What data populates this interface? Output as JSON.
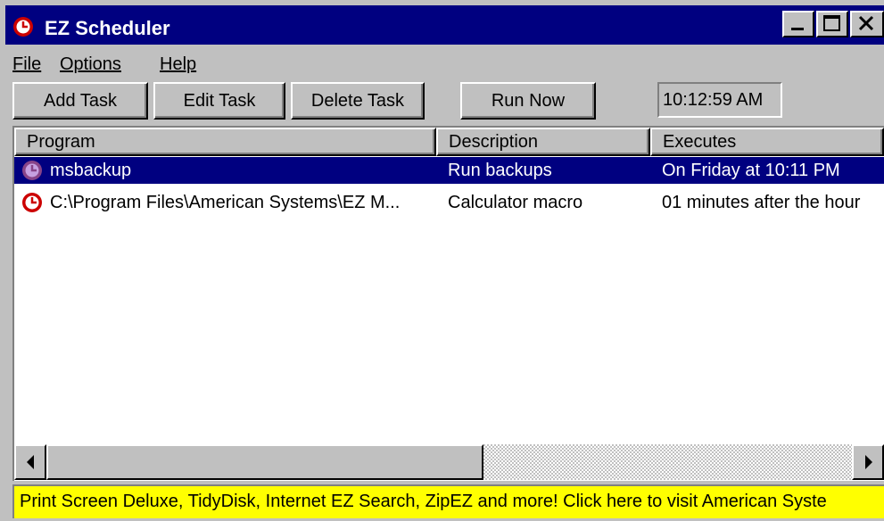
{
  "window": {
    "title": "EZ Scheduler",
    "icon": "clock-icon",
    "controls": [
      "minimize",
      "maximize",
      "close"
    ]
  },
  "menu": {
    "file": "File",
    "options": "Options",
    "help": "Help"
  },
  "toolbar": {
    "add_task": "Add Task",
    "edit_task": "Edit Task",
    "delete_task": "Delete Task",
    "run_now": "Run Now",
    "clock": "10:12:59 AM"
  },
  "table": {
    "columns": [
      "Program",
      "Description",
      "Executes"
    ],
    "rows": [
      {
        "program": "msbackup",
        "description": "Run backups",
        "executes": "On Friday at 10:11 PM",
        "icon": "clock-icon",
        "selected": true
      },
      {
        "program": "C:\\Program Files\\American Systems\\EZ M...",
        "description": "Calculator macro",
        "executes": "01 minutes after the hour",
        "icon": "clock-icon",
        "selected": false
      }
    ]
  },
  "status": {
    "text": "Print Screen Deluxe, TidyDisk, Internet EZ Search, ZipEZ and more!  Click here to visit American Syste"
  },
  "colors": {
    "titlebar": "#000080",
    "face": "#c0c0c0",
    "selection": "#000080",
    "statusbar": "#ffff00",
    "clock_icon": "#cc0000"
  }
}
